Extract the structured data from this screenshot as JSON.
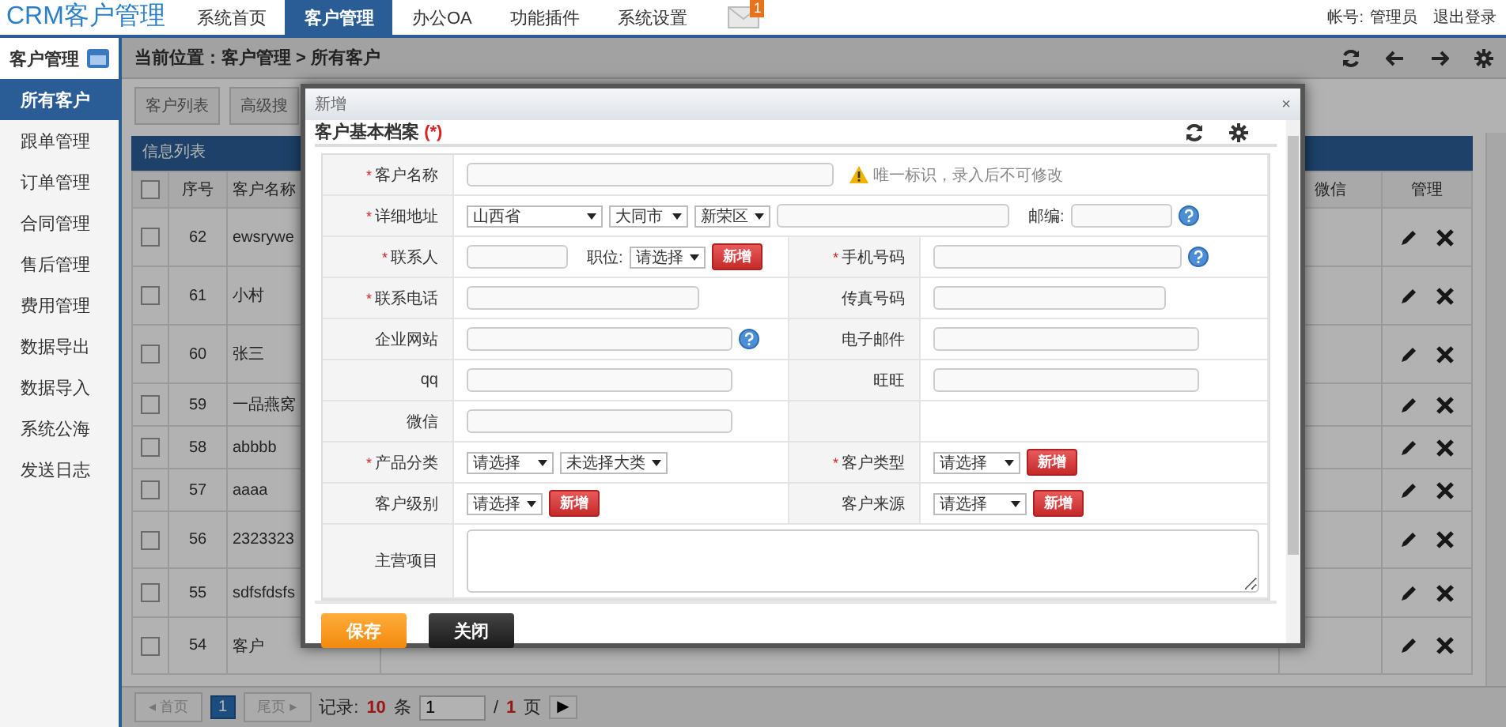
{
  "app": {
    "logo": "CRM客户管理",
    "nav": [
      {
        "label": "系统首页",
        "selected": false
      },
      {
        "label": "客户管理",
        "selected": true
      },
      {
        "label": "办公OA",
        "selected": false
      },
      {
        "label": "功能插件",
        "selected": false
      },
      {
        "label": "系统设置",
        "selected": false
      }
    ],
    "mail_badge": "1",
    "account_label": "帐号:",
    "account_name": "管理员",
    "logout": "退出登录"
  },
  "sidebar": {
    "title": "客户管理",
    "items": [
      {
        "label": "所有客户",
        "selected": true
      },
      {
        "label": "跟单管理",
        "selected": false
      },
      {
        "label": "订单管理",
        "selected": false
      },
      {
        "label": "合同管理",
        "selected": false
      },
      {
        "label": "售后管理",
        "selected": false
      },
      {
        "label": "费用管理",
        "selected": false
      },
      {
        "label": "数据导出",
        "selected": false
      },
      {
        "label": "数据导入",
        "selected": false
      },
      {
        "label": "系统公海",
        "selected": false
      },
      {
        "label": "发送日志",
        "selected": false
      }
    ]
  },
  "main": {
    "breadcrumb": "当前位置：客户管理 > 所有客户",
    "tabs": [
      "客户列表",
      "高级搜"
    ],
    "panel_title": "信息列表",
    "select_all_checked": false,
    "columns": [
      "序号",
      "客户名称",
      "微信",
      "管理"
    ],
    "rows": [
      {
        "no": "62",
        "name": "ewsrywe",
        "checked": false
      },
      {
        "no": "61",
        "name": "小村",
        "checked": false
      },
      {
        "no": "60",
        "name": "张三",
        "checked": false
      },
      {
        "no": "59",
        "name": "一品燕窝",
        "checked": false
      },
      {
        "no": "58",
        "name": "abbbb",
        "checked": false
      },
      {
        "no": "57",
        "name": "aaaa",
        "checked": false
      },
      {
        "no": "56",
        "name": "2323323",
        "checked": false
      },
      {
        "no": "55",
        "name": "sdfsfdsfs",
        "checked": false
      },
      {
        "no": "54",
        "name": "客户",
        "checked": false
      }
    ],
    "pagination": {
      "first": "◂ 首页",
      "page": "1",
      "last": "尾页 ▸",
      "records_label": "记录:",
      "records_count": "10",
      "records_unit": "条",
      "page_input": "1",
      "slash": "/",
      "total_pages": "1",
      "pages_unit": "页",
      "go": "▶"
    }
  },
  "dialog": {
    "title": "新增",
    "close": "×",
    "heading": "客户基本档案",
    "required_mark": "(*)",
    "rows": [
      {
        "cells": [
          {
            "mark": "*",
            "label": "客户名称",
            "controls": [
              {
                "kind": "text"
              },
              {
                "kind": "hint",
                "text": "唯一标识，录入后不可修改"
              }
            ]
          }
        ]
      },
      {
        "cells": [
          {
            "mark": "*",
            "label": "详细地址",
            "controls": [
              {
                "kind": "select",
                "value": "山西省"
              },
              {
                "kind": "select",
                "value": "大同市"
              },
              {
                "kind": "select",
                "value": "新荣区"
              },
              {
                "kind": "text"
              },
              {
                "kind": "caption",
                "text": "邮编:"
              },
              {
                "kind": "text"
              },
              {
                "kind": "help"
              }
            ]
          }
        ]
      },
      {
        "cells": [
          {
            "mark": "*",
            "label": "联系人",
            "controls": [
              {
                "kind": "text"
              },
              {
                "kind": "caption",
                "text": "职位:"
              },
              {
                "kind": "select",
                "value": "请选择"
              },
              {
                "kind": "button",
                "text": "新增"
              }
            ]
          },
          {
            "mark": "*",
            "label": "手机号码",
            "controls": [
              {
                "kind": "text"
              },
              {
                "kind": "help"
              }
            ]
          }
        ]
      },
      {
        "cells": [
          {
            "mark": "*",
            "label": "联系电话",
            "controls": [
              {
                "kind": "text"
              }
            ]
          },
          {
            "label": "传真号码",
            "controls": [
              {
                "kind": "text"
              }
            ]
          }
        ]
      },
      {
        "cells": [
          {
            "label": "企业网站",
            "controls": [
              {
                "kind": "text"
              },
              {
                "kind": "help"
              }
            ]
          },
          {
            "label": "电子邮件",
            "controls": [
              {
                "kind": "text"
              }
            ]
          }
        ]
      },
      {
        "cells": [
          {
            "label": "qq",
            "controls": [
              {
                "kind": "text"
              }
            ]
          },
          {
            "label": "旺旺",
            "controls": [
              {
                "kind": "text"
              }
            ]
          }
        ]
      },
      {
        "cells": [
          {
            "label": "微信",
            "controls": [
              {
                "kind": "text"
              }
            ]
          },
          {}
        ]
      },
      {
        "cells": [
          {
            "mark": "*",
            "label": "产品分类",
            "controls": [
              {
                "kind": "select",
                "value": "请选择"
              },
              {
                "kind": "select",
                "value": "未选择大类"
              }
            ]
          },
          {
            "mark": "*",
            "label": "客户类型",
            "controls": [
              {
                "kind": "select",
                "value": "请选择"
              },
              {
                "kind": "button",
                "text": "新增"
              }
            ]
          }
        ]
      },
      {
        "cells": [
          {
            "label": "客户级别",
            "controls": [
              {
                "kind": "select",
                "value": "请选择"
              },
              {
                "kind": "button",
                "text": "新增"
              }
            ]
          },
          {
            "label": "客户来源",
            "controls": [
              {
                "kind": "select",
                "value": "请选择"
              },
              {
                "kind": "button",
                "text": "新增"
              }
            ]
          }
        ]
      },
      {
        "cells": [
          {
            "label": "主营项目",
            "controls": [
              {
                "kind": "textarea"
              }
            ]
          }
        ]
      }
    ],
    "buttons": [
      {
        "label": "保存",
        "kind": "primary"
      },
      {
        "label": "关闭",
        "kind": "dark"
      }
    ]
  }
}
